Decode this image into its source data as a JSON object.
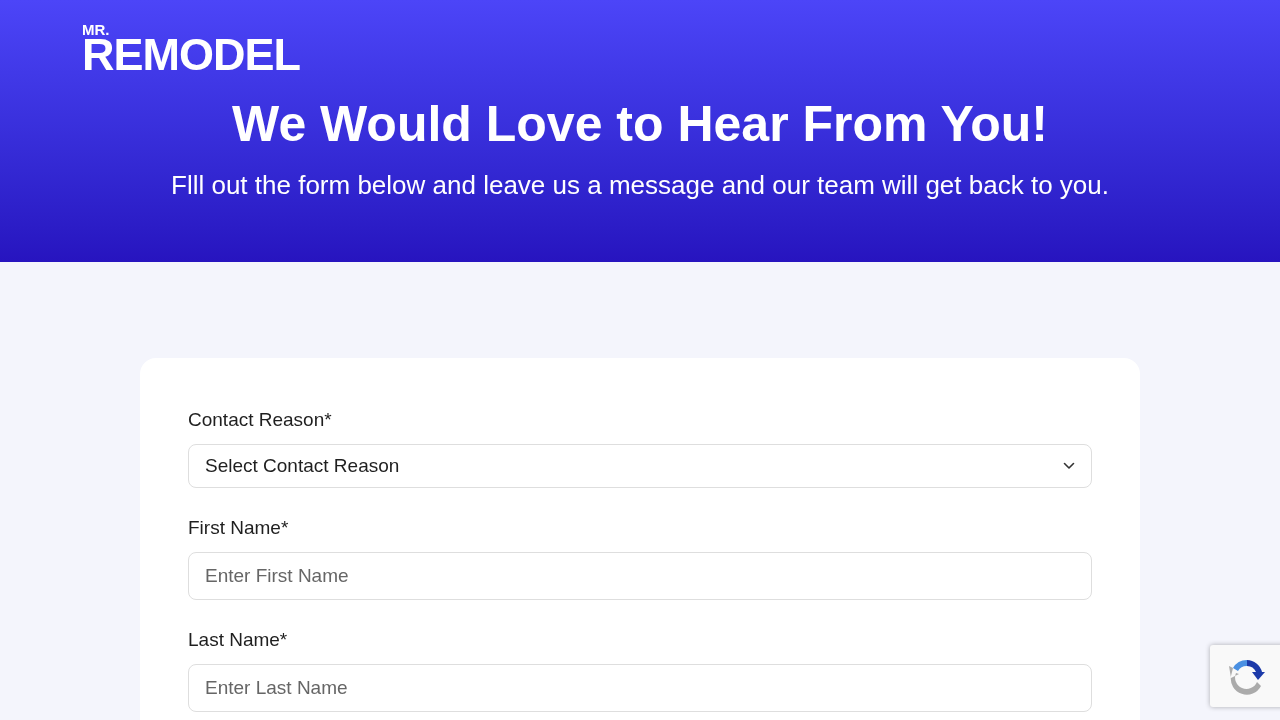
{
  "header": {
    "logo": {
      "prefix": "MR.",
      "wordmark": "REMODEL"
    },
    "title": "We Would Love to Hear From You!",
    "subtitle": "Flll out the form below and leave us a message and our team will get back to you."
  },
  "form": {
    "fields": [
      {
        "kind": "select",
        "label": "Contact Reason*",
        "value": "Select Contact Reason"
      },
      {
        "kind": "text",
        "label": "First Name*",
        "placeholder": "Enter First Name"
      },
      {
        "kind": "text",
        "label": "Last Name*",
        "placeholder": "Enter Last Name"
      }
    ]
  }
}
